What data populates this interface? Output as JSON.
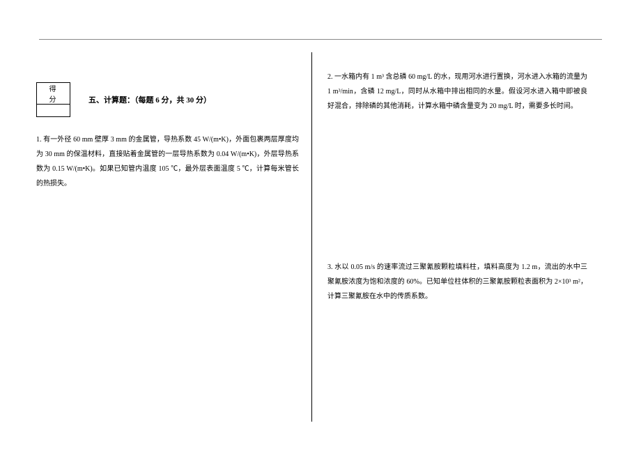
{
  "scoreBox": {
    "label": "得 分"
  },
  "section": {
    "title": "五、计算题：（每题 6 分，共 30 分）"
  },
  "questions": {
    "q1": "1. 有一外径 60 mm 壁厚 3 mm 的金属管，导热系数 45 W/(m•K)，外面包裹两层厚度均为 30 mm 的保温材料，直接贴着金属管的一层导热系数为 0.04 W/(m•K)，外层导热系数为 0.15 W/(m•K)。如果已知管内温度 105 ℃，最外层表面温度 5 ℃，计算每米管长的热损失。",
    "q2": "2. 一水箱内有 1 m³ 含总磷 60 mg/L 的水，现用河水进行置换，河水进入水箱的流量为 1 m³/min，含磷 12 mg/L，同时从水箱中排出相同的水量。假设河水进入箱中即被良好混合，排除磷的其他消耗，计算水箱中磷含量变为 20 mg/L 时，需要多长时间。",
    "q3": "3. 水以 0.05 m/s 的速率流过三聚氰胺颗粒填料柱，填料高度为 1.2 m，流出的水中三聚氰胺浓度为饱和浓度的 60%。已知单位柱体积的三聚氰胺颗粒表面积为 2×10³ m²，计算三聚氰胺在水中的传质系数。"
  }
}
